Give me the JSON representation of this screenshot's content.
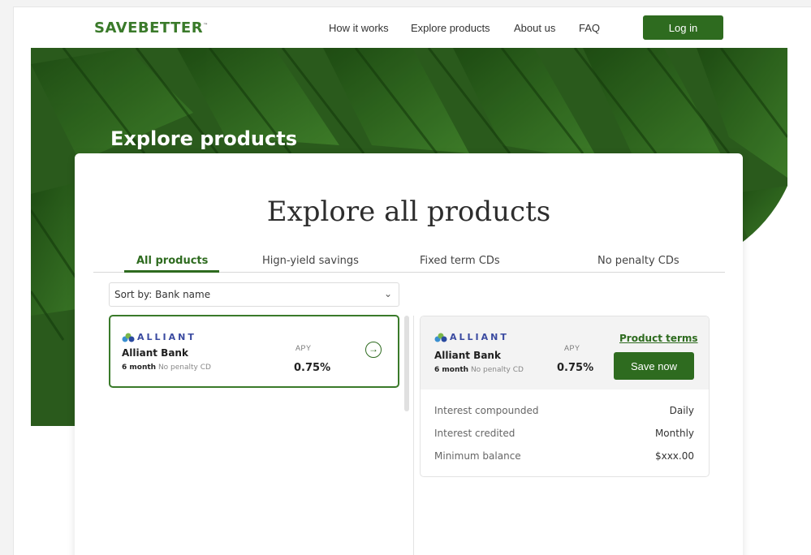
{
  "header": {
    "logo_save": "SAVE",
    "logo_better": "BETTER",
    "logo_tm": "™",
    "nav": [
      "How it works",
      "Explore products",
      "About us",
      "FAQ"
    ],
    "login_label": "Log in"
  },
  "hero": {
    "title": "Explore products"
  },
  "main": {
    "title": "Explore all products",
    "tabs": [
      "All products",
      "Hign-yield savings",
      "Fixed term CDs",
      "No penalty CDs"
    ],
    "active_tab": 0,
    "sort_label": "Sort by: Bank name"
  },
  "product_card": {
    "brand": "ALLIANT",
    "bank_name": "Alliant Bank",
    "term_bold": "6 month",
    "term_rest": "No penalty CD",
    "apy_label": "APY",
    "apy_value": "0.75%"
  },
  "detail": {
    "brand": "ALLIANT",
    "bank_name": "Alliant Bank",
    "term_bold": "6 month",
    "term_rest": "No penalty CD",
    "apy_label": "APY",
    "apy_value": "0.75%",
    "terms_link": "Product terms",
    "save_label": "Save now",
    "rows": [
      {
        "label": "Interest compounded",
        "value": "Daily"
      },
      {
        "label": "Interest credited",
        "value": "Monthly"
      },
      {
        "label": "Minimum balance",
        "value": "$xxx.00"
      }
    ]
  },
  "colors": {
    "brand_green": "#2e6b1f",
    "alliant_blue": "#3a4aa0"
  },
  "icons": {
    "arrow": "arrow-right-circle-icon",
    "chevron": "chevron-down-icon",
    "logo": "alliant-logo-icon"
  }
}
